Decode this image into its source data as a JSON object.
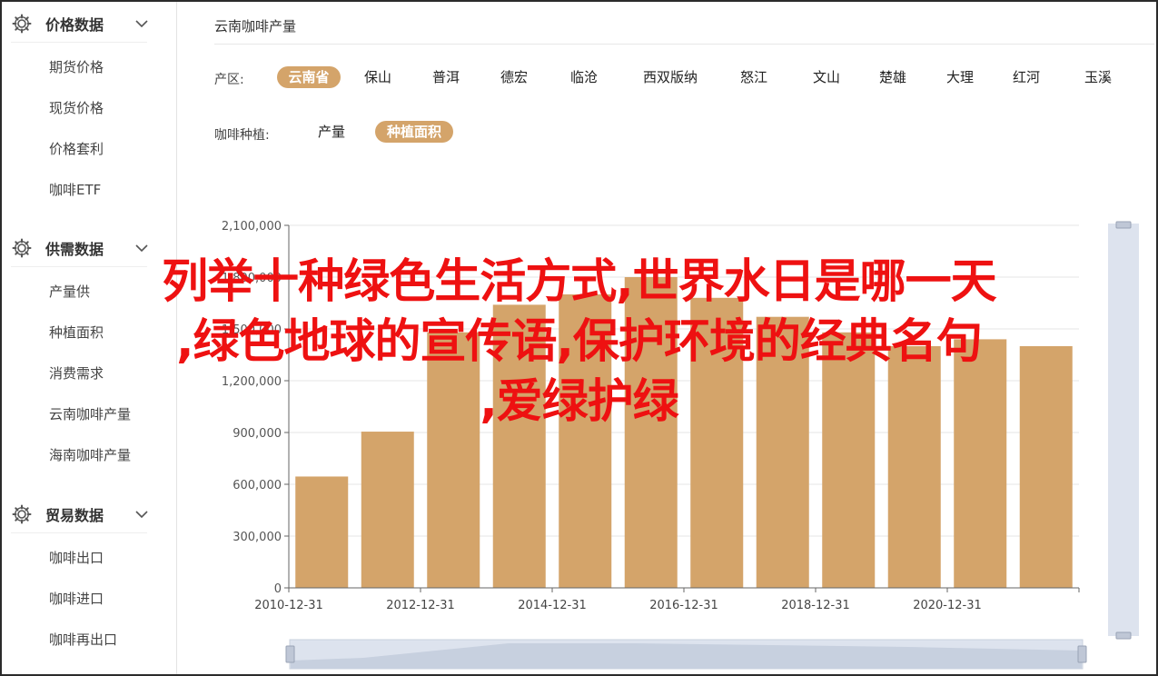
{
  "sidebar": {
    "sections": [
      {
        "title": "价格数据",
        "icon": "gear-icon",
        "items": [
          "期货价格",
          "现货价格",
          "价格套利",
          "咖啡ETF"
        ]
      },
      {
        "title": "供需数据",
        "icon": "gear-icon",
        "items": [
          "产量供",
          "种植面积",
          "消费需求",
          "云南咖啡产量",
          "海南咖啡产量"
        ]
      },
      {
        "title": "贸易数据",
        "icon": "gear-icon",
        "items": [
          "咖啡出口",
          "咖啡进口",
          "咖啡再出口"
        ]
      }
    ]
  },
  "main": {
    "title": "云南咖啡产量",
    "filters": {
      "region_label": "产区:",
      "regions": [
        "云南省",
        "保山",
        "普洱",
        "德宏",
        "临沧",
        "西双版纳",
        "怒江",
        "文山",
        "楚雄",
        "大理",
        "红河",
        "玉溪"
      ],
      "region_selected": "云南省",
      "type_label": "咖啡种植:",
      "types": [
        "产量",
        "种植面积"
      ],
      "type_selected": "种植面积"
    }
  },
  "chart_data": {
    "type": "bar",
    "categories": [
      "2010-12-31",
      "2011-12-31",
      "2012-12-31",
      "2013-12-31",
      "2014-12-31",
      "2015-12-31",
      "2016-12-31",
      "2017-12-31",
      "2018-12-31",
      "2019-12-31",
      "2020-12-31",
      "2021-12-31"
    ],
    "x_tick_labels": [
      "2010-12-31",
      "2012-12-31",
      "2014-12-31",
      "2016-12-31",
      "2018-12-31",
      "2020-12-31"
    ],
    "values": [
      645000,
      905000,
      1480000,
      1640000,
      1700000,
      1800000,
      1680000,
      1570000,
      1480000,
      1400000,
      1440000,
      1400000
    ],
    "ylim": [
      0,
      2100000
    ],
    "y_ticks": [
      "0",
      "300,000",
      "600,000",
      "900,000",
      "1,200,000",
      "1,500,000",
      "1,800,000",
      "2,100,000"
    ],
    "bar_color": "#d4a46a",
    "grid": true
  },
  "overlay": {
    "lines": [
      "列举十种绿色生活方式,世界水日是哪一天",
      ",绿色地球的宣传语,保护环境的经典名句",
      ",爱绿护绿"
    ],
    "color": "#ee1111"
  }
}
